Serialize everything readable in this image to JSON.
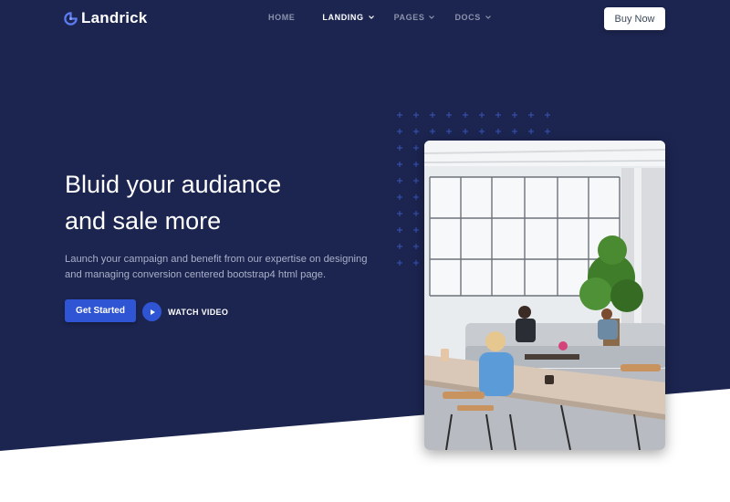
{
  "brand": {
    "name": "Landrick",
    "logo_icon": "landrick-logo-icon"
  },
  "nav": {
    "items": [
      {
        "label": "HOME",
        "active": false,
        "dropdown": false
      },
      {
        "label": "LANDING",
        "active": true,
        "dropdown": true
      },
      {
        "label": "PAGES",
        "active": false,
        "dropdown": true
      },
      {
        "label": "DOCS",
        "active": false,
        "dropdown": true
      }
    ],
    "buy_label": "Buy Now"
  },
  "hero": {
    "headline_line1": "Bluid your audiance",
    "headline_line2": "and sale more",
    "subtext": "Launch your campaign and benefit from our expertise on designing and managing conversion centered bootstrap4 html page.",
    "cta_label": "Get Started",
    "watch_label": "WATCH VIDEO"
  },
  "colors": {
    "hero_bg": "#1c2550",
    "accent": "#2f55d4",
    "muted_text": "#a9b0c9",
    "nav_text": "#8c93ad"
  }
}
